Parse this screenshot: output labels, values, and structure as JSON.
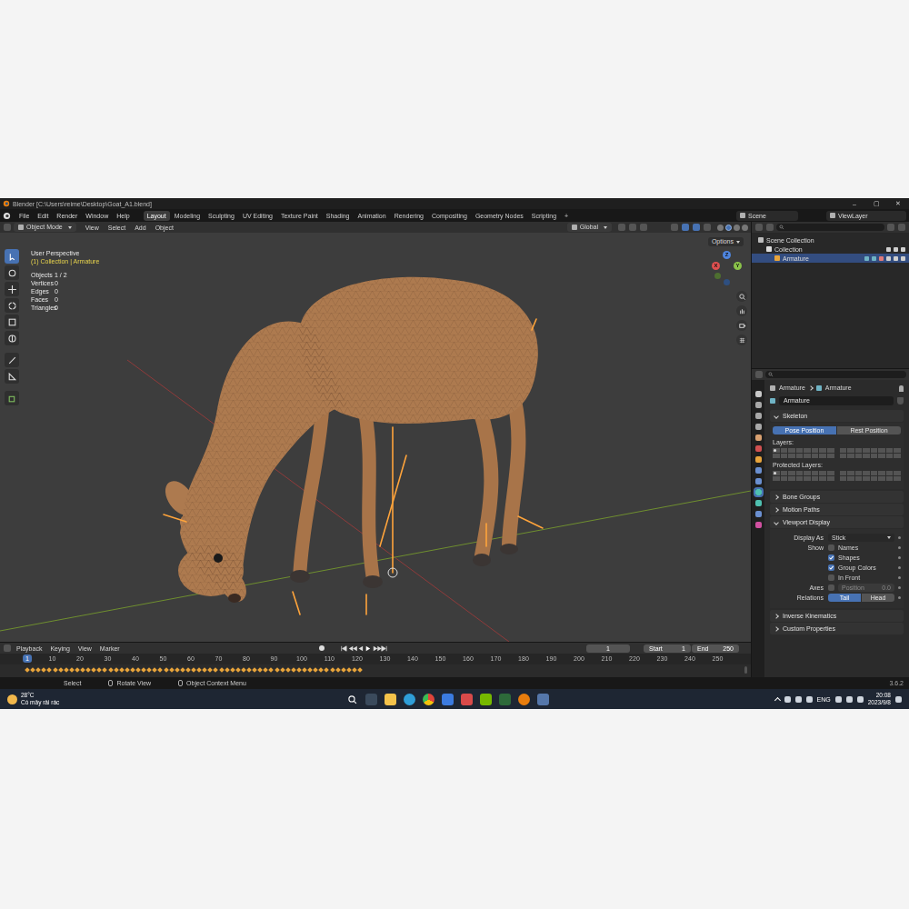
{
  "window": {
    "title": "Blender [C:\\Users\\reime\\Desktop\\Goat_A1.blend]",
    "controls": [
      "–",
      "▢",
      "✕"
    ]
  },
  "menu": [
    "File",
    "Edit",
    "Render",
    "Window",
    "Help"
  ],
  "workspaces": [
    {
      "label": "Layout",
      "selected": true
    },
    {
      "label": "Modeling",
      "selected": false
    },
    {
      "label": "Sculpting",
      "selected": false
    },
    {
      "label": "UV Editing",
      "selected": false
    },
    {
      "label": "Texture Paint",
      "selected": false
    },
    {
      "label": "Shading",
      "selected": false
    },
    {
      "label": "Animation",
      "selected": false
    },
    {
      "label": "Rendering",
      "selected": false
    },
    {
      "label": "Compositing",
      "selected": false
    },
    {
      "label": "Geometry Nodes",
      "selected": false
    },
    {
      "label": "Scripting",
      "selected": false
    }
  ],
  "add_workspace": "+",
  "scene": "Scene",
  "view_layer": "ViewLayer",
  "viewport": {
    "mode": "Object Mode",
    "menus": [
      "View",
      "Select",
      "Add",
      "Object"
    ],
    "orientation": "Global",
    "options": "Options",
    "perspective": "User Perspective",
    "context": "(1) Collection | Armature",
    "stats": [
      {
        "label": "Objects",
        "value": "1 / 2"
      },
      {
        "label": "Vertices",
        "value": "0"
      },
      {
        "label": "Edges",
        "value": "0"
      },
      {
        "label": "Faces",
        "value": "0"
      },
      {
        "label": "Triangles",
        "value": "0"
      }
    ],
    "gizmo": [
      "X",
      "Y",
      "Z"
    ]
  },
  "outliner": {
    "items": [
      {
        "label": "Scene Collection",
        "depth": 0,
        "selected": false
      },
      {
        "label": "Collection",
        "depth": 1,
        "selected": false
      },
      {
        "label": "Armature",
        "depth": 2,
        "selected": true
      }
    ]
  },
  "properties": {
    "breadcrumb": [
      "Armature",
      "Armature"
    ],
    "name": "Armature",
    "sections": [
      {
        "title": "Skeleton",
        "kind": "skeleton",
        "expanded": true,
        "pose_options": [
          {
            "label": "Pose Position",
            "selected": true
          },
          {
            "label": "Rest Position",
            "selected": false
          }
        ],
        "layers_label": "Layers:",
        "layers_used": [
          1
        ],
        "protected_label": "Protected Layers:",
        "protected_used": [
          1
        ]
      },
      {
        "title": "Bone Groups",
        "kind": "plain",
        "expanded": false
      },
      {
        "title": "Motion Paths",
        "kind": "plain",
        "expanded": false
      },
      {
        "title": "Viewport Display",
        "kind": "viewport_display",
        "expanded": true,
        "display_as": {
          "label": "Display As",
          "value": "Stick"
        },
        "show_label": "Show",
        "show": [
          {
            "label": "Names",
            "checked": false
          },
          {
            "label": "Shapes",
            "checked": true
          },
          {
            "label": "Group Colors",
            "checked": true
          },
          {
            "label": "In Front",
            "checked": false
          }
        ],
        "axes": {
          "label": "Axes",
          "checked": false,
          "field_label": "Position",
          "value": "0.0"
        },
        "relations": {
          "label": "Relations",
          "options": [
            {
              "label": "Tail",
              "selected": true
            },
            {
              "label": "Head",
              "selected": false
            }
          ]
        }
      },
      {
        "title": "Inverse Kinematics",
        "kind": "plain",
        "expanded": false
      },
      {
        "title": "Custom Properties",
        "kind": "plain",
        "expanded": false
      }
    ]
  },
  "timeline": {
    "menus": [
      "Playback",
      "Keying",
      "View",
      "Marker"
    ],
    "frame": "1",
    "start_label": "Start",
    "start": "1",
    "end_label": "End",
    "end": "250",
    "current": "1",
    "ruler": [
      "10",
      "20",
      "30",
      "40",
      "50",
      "60",
      "70",
      "80",
      "90",
      "100",
      "110",
      "120",
      "130",
      "140",
      "150",
      "160",
      "170",
      "180",
      "190",
      "200",
      "210",
      "220",
      "230",
      "240",
      "250"
    ],
    "keyframes": {
      "first": 1,
      "last": 122,
      "step": 2
    }
  },
  "status_bar": {
    "items": [
      "Select",
      "Rotate View",
      "Object Context Menu"
    ],
    "version": "3.6.2"
  },
  "taskbar": {
    "temperature": "28°C",
    "weather": "Có mây rải rác",
    "language": "ENG",
    "time": "20:08",
    "date": "2023/9/8"
  }
}
